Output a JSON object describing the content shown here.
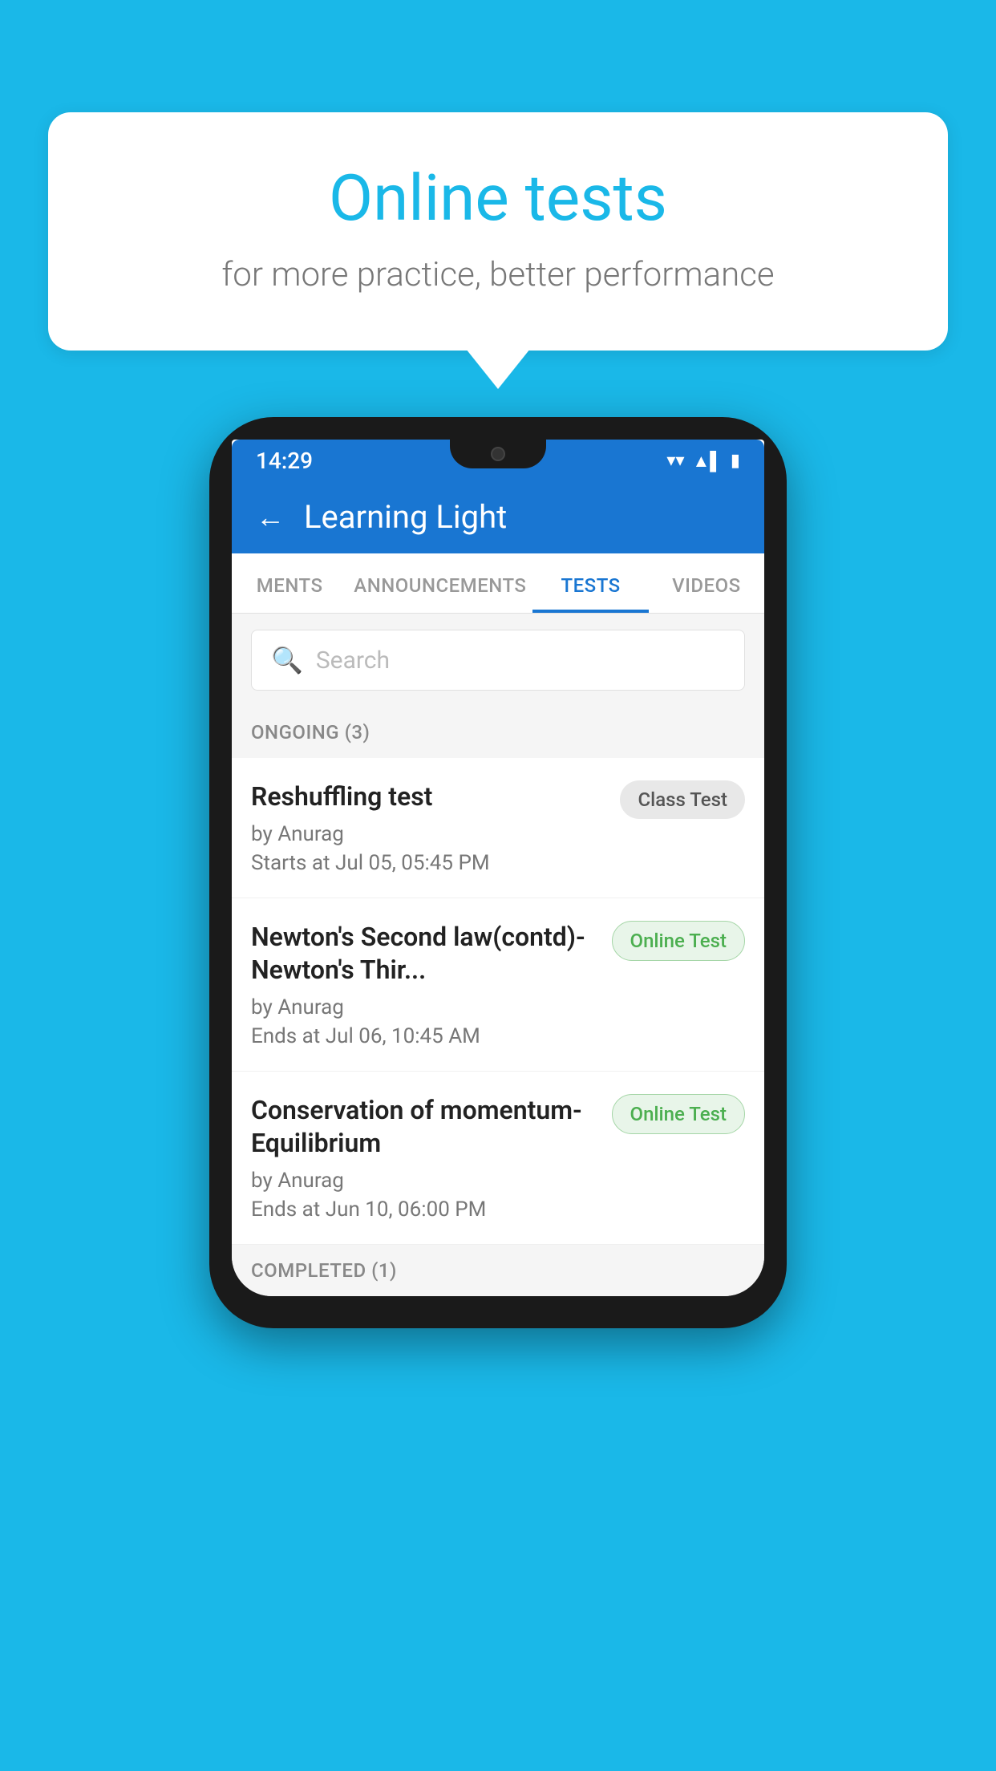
{
  "background": {
    "color": "#1ab8e8"
  },
  "speech_bubble": {
    "title": "Online tests",
    "subtitle": "for more practice, better performance"
  },
  "phone": {
    "status_bar": {
      "time": "14:29",
      "wifi_icon": "▼",
      "signal_icon": "▲",
      "battery_icon": "▮"
    },
    "header": {
      "back_label": "←",
      "title": "Learning Light"
    },
    "tabs": [
      {
        "label": "MENTS",
        "active": false
      },
      {
        "label": "ANNOUNCEMENTS",
        "active": false
      },
      {
        "label": "TESTS",
        "active": true
      },
      {
        "label": "VIDEOS",
        "active": false
      }
    ],
    "search": {
      "placeholder": "Search",
      "icon": "🔍"
    },
    "ongoing_section": {
      "title": "ONGOING (3)",
      "items": [
        {
          "name": "Reshuffling test",
          "author": "by Anurag",
          "time_label": "Starts at",
          "time": "Jul 05, 05:45 PM",
          "badge": "Class Test",
          "badge_type": "class"
        },
        {
          "name": "Newton's Second law(contd)-Newton's Thir...",
          "author": "by Anurag",
          "time_label": "Ends at",
          "time": "Jul 06, 10:45 AM",
          "badge": "Online Test",
          "badge_type": "online"
        },
        {
          "name": "Conservation of momentum-Equilibrium",
          "author": "by Anurag",
          "time_label": "Ends at",
          "time": "Jun 10, 06:00 PM",
          "badge": "Online Test",
          "badge_type": "online"
        }
      ]
    },
    "completed_section": {
      "title": "COMPLETED (1)"
    }
  }
}
